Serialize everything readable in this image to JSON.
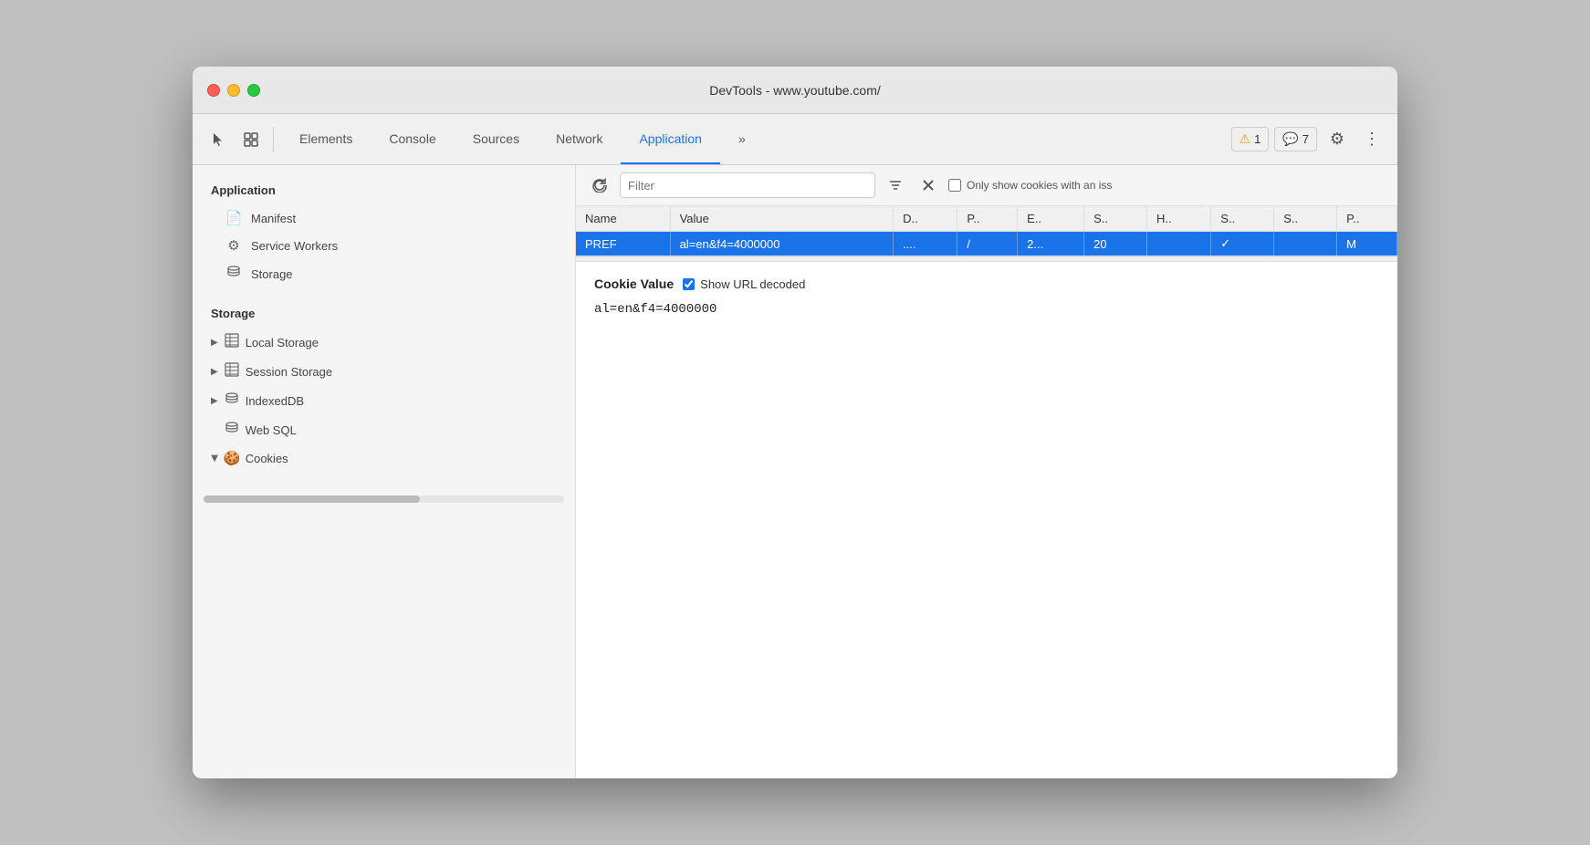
{
  "window": {
    "title": "DevTools - www.youtube.com/"
  },
  "toolbar": {
    "tabs": [
      {
        "id": "elements",
        "label": "Elements",
        "active": false
      },
      {
        "id": "console",
        "label": "Console",
        "active": false
      },
      {
        "id": "sources",
        "label": "Sources",
        "active": false
      },
      {
        "id": "network",
        "label": "Network",
        "active": false
      },
      {
        "id": "application",
        "label": "Application",
        "active": true
      },
      {
        "id": "more",
        "label": "»",
        "active": false
      }
    ],
    "warn_count": "1",
    "info_count": "7",
    "settings_icon": "⚙",
    "more_icon": "⋮"
  },
  "sidebar": {
    "application_section": "Application",
    "items_application": [
      {
        "id": "manifest",
        "label": "Manifest",
        "icon": "📄"
      },
      {
        "id": "service-workers",
        "label": "Service Workers",
        "icon": "⚙"
      },
      {
        "id": "storage-app",
        "label": "Storage",
        "icon": "🗄"
      }
    ],
    "storage_section": "Storage",
    "items_storage": [
      {
        "id": "local-storage",
        "label": "Local Storage",
        "icon": "▦",
        "expandable": true,
        "expanded": false
      },
      {
        "id": "session-storage",
        "label": "Session Storage",
        "icon": "▦",
        "expandable": true,
        "expanded": false
      },
      {
        "id": "indexeddb",
        "label": "IndexedDB",
        "icon": "🗄",
        "expandable": true,
        "expanded": false
      },
      {
        "id": "web-sql",
        "label": "Web SQL",
        "icon": "🗄",
        "expandable": false
      },
      {
        "id": "cookies",
        "label": "Cookies",
        "icon": "🍪",
        "expandable": true,
        "expanded": true
      }
    ]
  },
  "filter": {
    "placeholder": "Filter",
    "only_issues_label": "Only show cookies with an iss"
  },
  "table": {
    "columns": [
      "Name",
      "Value",
      "D..",
      "P..",
      "E..",
      "S..",
      "H..",
      "S..",
      "S..",
      "P.."
    ],
    "rows": [
      {
        "name": "PREF",
        "value": "al=en&f4=4000000",
        "domain": "....",
        "path": "/",
        "expires": "2...",
        "size": "20",
        "httponly": "",
        "secure": "✓",
        "samesite": "",
        "priority": "M"
      }
    ]
  },
  "cookie_detail": {
    "label": "Cookie Value",
    "show_url_decoded_label": "Show URL decoded",
    "value": "al=en&f4=4000000"
  }
}
